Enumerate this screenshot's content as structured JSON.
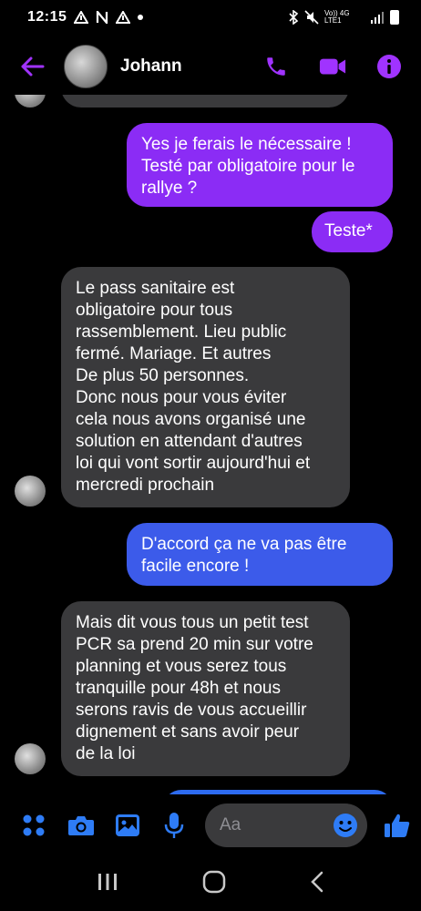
{
  "status_bar": {
    "time": "12:15",
    "network": "Vo)) 4G LTE1"
  },
  "header": {
    "contact_name": "Johann"
  },
  "messages": [
    {
      "from": "me",
      "text": "Yes je ferais le nécessaire !\nTesté par obligatoire pour le\nrallye ?"
    },
    {
      "from": "me",
      "text": "Teste*"
    },
    {
      "from": "them",
      "text": "Le pass sanitaire est\nobligatoire pour tous\nrassemblement. Lieu public\nfermé. Mariage. Et autres\nDe plus 50 personnes.\nDonc nous pour vous éviter\ncela nous avons organisé une\nsolution en attendant d'autres\nloi qui vont sortir aujourd'hui et\nmercredi prochain"
    },
    {
      "from": "me",
      "text": "D'accord ça ne va pas être\nfacile encore !"
    },
    {
      "from": "them",
      "text": "Mais dit vous tous un petit test\nPCR sa prend 20 min sur votre\nplanning et vous serez tous\ntranquille pour 48h et nous\nserons ravis de vous accueillir\ndignement et sans avoir peur\nde la loi"
    }
  ],
  "composer": {
    "placeholder": "Aa"
  },
  "colors": {
    "accent": "#a033ff",
    "blue": "#2e7cf6",
    "purple_bubble": "#8b2cf5",
    "blue_bubble": "#3c5bea",
    "incoming": "#3a3a3c"
  },
  "icons": {
    "header": [
      "back-arrow-icon",
      "phone-icon",
      "video-icon",
      "info-icon"
    ],
    "composer": [
      "apps-icon",
      "camera-icon",
      "gallery-icon",
      "microphone-icon",
      "emoji-icon",
      "thumbs-up-icon"
    ],
    "nav": [
      "recents-icon",
      "home-icon",
      "back-icon"
    ]
  }
}
